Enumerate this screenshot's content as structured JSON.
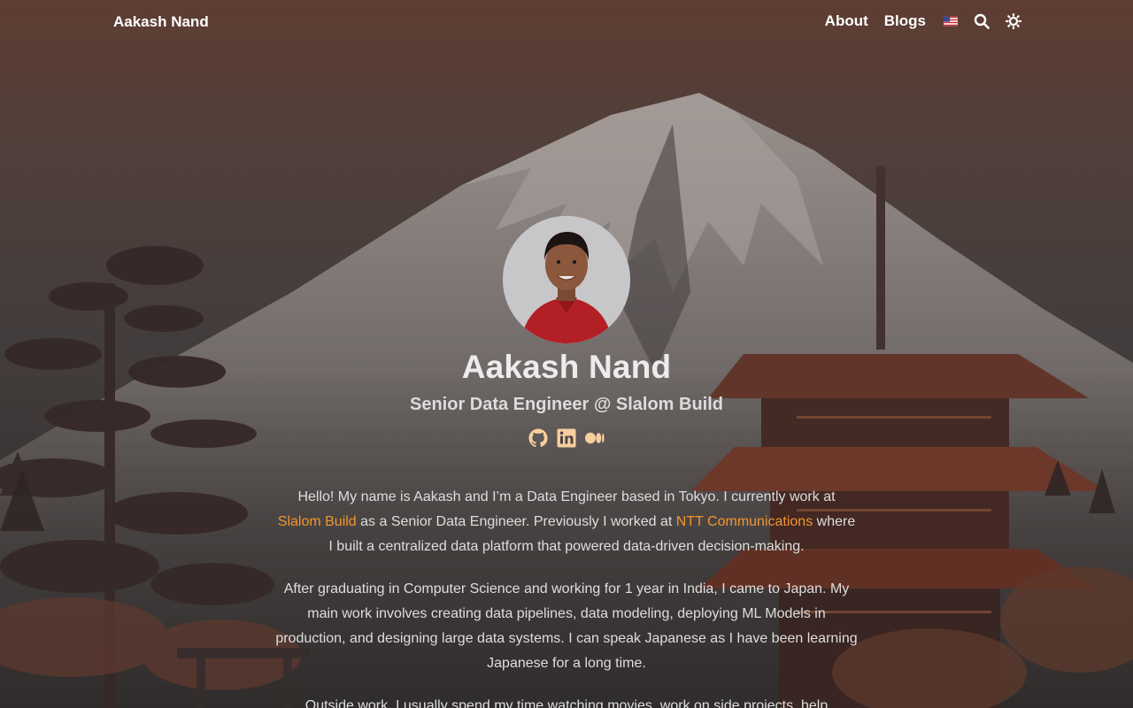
{
  "header": {
    "brand": "Aakash Nand",
    "nav": {
      "about": "About",
      "blogs": "Blogs"
    },
    "icons": [
      "us-flag-icon",
      "search-icon",
      "theme-toggle-icon"
    ]
  },
  "profile": {
    "name": "Aakash Nand",
    "title": "Senior Data Engineer @ Slalom Build",
    "socials": [
      "github-icon",
      "linkedin-icon",
      "medium-icon"
    ]
  },
  "bio": {
    "p1_before": "Hello! My name is Aakash and I’m a Data Engineer based in Tokyo. I currently work at ",
    "p1_link1": "Slalom Build",
    "p1_middle": " as a Senior Data Engineer. Previously I worked at ",
    "p1_link2": "NTT Communications",
    "p1_after": " where I built a centralized data platform that powered data-driven decision-making.",
    "p2": "After graduating in Computer Science and working for 1 year in India, I came to Japan. My main work involves creating data pipelines, data modeling, deploying ML Models in production, and designing large data systems. I can speak Japanese as I have been learning Japanese for a long time.",
    "p3": "Outside work, I usually spend my time watching movies, work on side projects, help"
  },
  "colors": {
    "accent": "#f4952f",
    "social_icon": "#f7cf9e",
    "text": "#dedede"
  }
}
